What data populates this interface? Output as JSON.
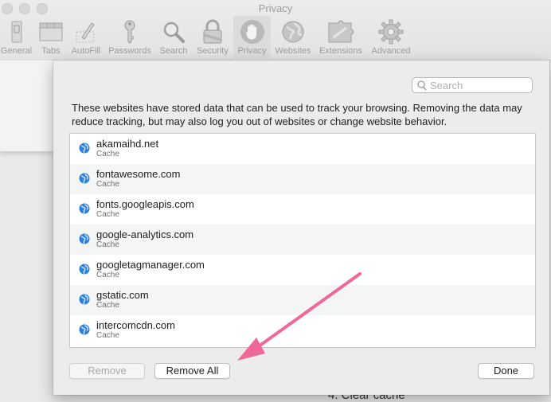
{
  "window": {
    "title": "Privacy"
  },
  "toolbar": {
    "items": [
      {
        "label": "General",
        "icon": "general-icon"
      },
      {
        "label": "Tabs",
        "icon": "tabs-icon"
      },
      {
        "label": "AutoFill",
        "icon": "pencil-icon"
      },
      {
        "label": "Passwords",
        "icon": "key-icon"
      },
      {
        "label": "Search",
        "icon": "magnifier-icon"
      },
      {
        "label": "Security",
        "icon": "lock-icon"
      },
      {
        "label": "Privacy",
        "icon": "hand-icon",
        "active": true
      },
      {
        "label": "Websites",
        "icon": "globe-icon"
      },
      {
        "label": "Extensions",
        "icon": "puzzle-icon"
      },
      {
        "label": "Advanced",
        "icon": "gear-icon"
      }
    ]
  },
  "sheet": {
    "search_placeholder": "Search",
    "description": "These websites have stored data that can be used to track your browsing. Removing the data may reduce tracking, but may also log you out of websites or change website behavior.",
    "websites": [
      {
        "domain": "akamaihd.net",
        "type": "Cache"
      },
      {
        "domain": "fontawesome.com",
        "type": "Cache"
      },
      {
        "domain": "fonts.googleapis.com",
        "type": "Cache"
      },
      {
        "domain": "google-analytics.com",
        "type": "Cache"
      },
      {
        "domain": "googletagmanager.com",
        "type": "Cache"
      },
      {
        "domain": "gstatic.com",
        "type": "Cache"
      },
      {
        "domain": "intercomcdn.com",
        "type": "Cache"
      }
    ],
    "buttons": {
      "remove": "Remove",
      "remove_all": "Remove All",
      "done": "Done"
    }
  },
  "background": {
    "partial_text": "4. Clear cache"
  },
  "annotation": {
    "arrow_color": "#f0679a"
  }
}
